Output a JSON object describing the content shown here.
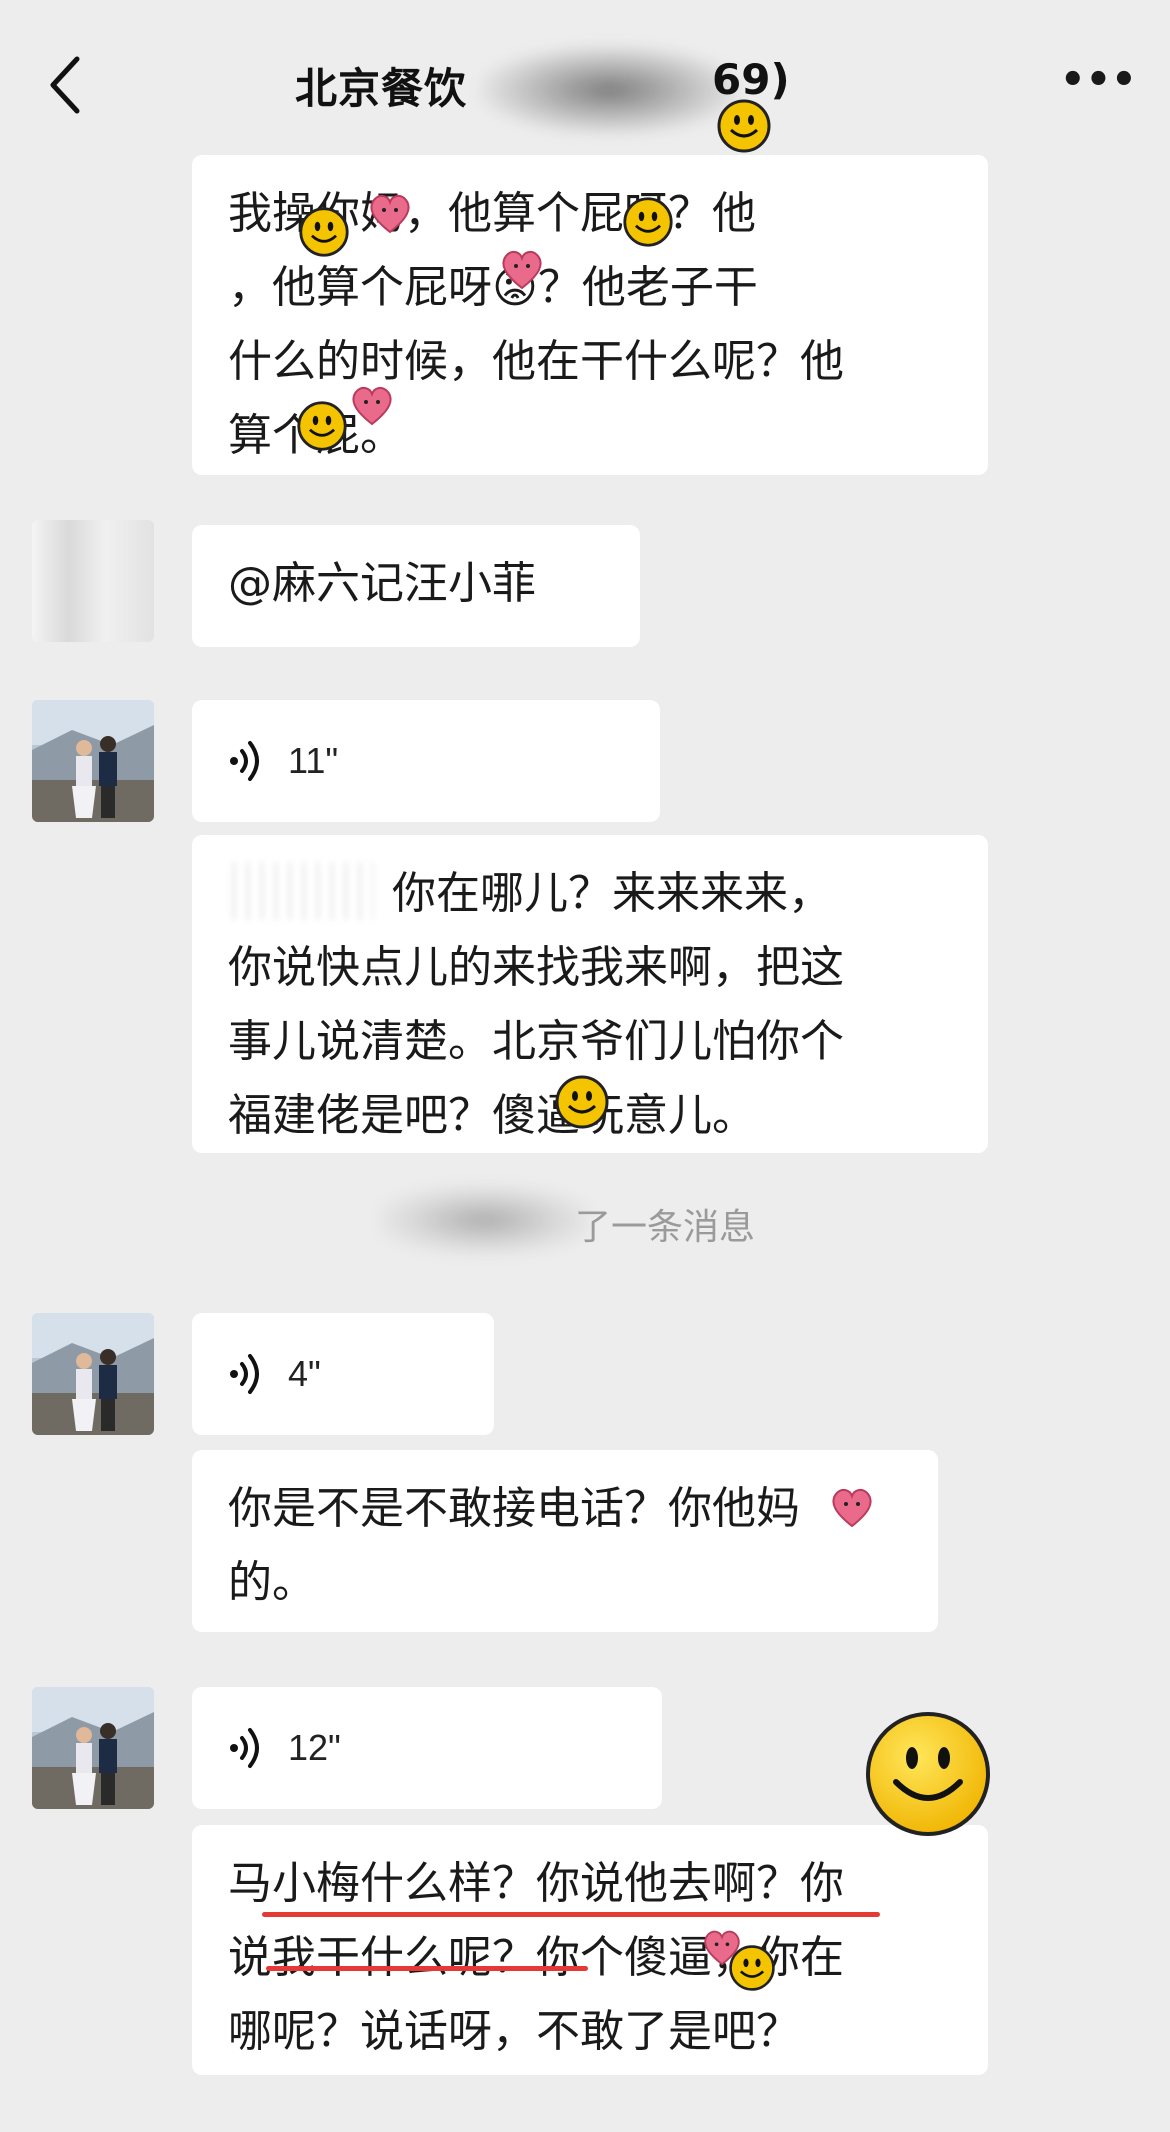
{
  "header": {
    "title": "北京餐饮",
    "title_tail": "69)",
    "back_icon": "chevron-left-icon",
    "more_icon": "more-icon",
    "more_label": "•••"
  },
  "messages": [
    {
      "kind": "text",
      "lines": [
        "我操你妈，他算个屁呀？他",
        "，他算个屁呀😡？他老子干",
        "什么的时候，他在干什么呢？他",
        "算个屁。"
      ]
    },
    {
      "kind": "text",
      "lines": [
        "@麻六记汪小菲"
      ]
    },
    {
      "kind": "voice",
      "duration": "11\""
    },
    {
      "kind": "text",
      "lines": [
        "，你在哪儿？来来来来，",
        "你说快点儿的来找我来啊，把这",
        "事儿说清楚。北京爷们儿怕你个",
        "福建佬是吧？傻逼玩意儿。"
      ]
    },
    {
      "kind": "voice",
      "duration": "4\""
    },
    {
      "kind": "text",
      "lines": [
        "你是不是不敢接电话？你他妈",
        "的。"
      ]
    },
    {
      "kind": "voice",
      "duration": "12\""
    },
    {
      "kind": "text",
      "lines": [
        "马小梅什么样？你说他去啊？你",
        "说我干什么呢？你个傻逼，你在",
        "哪呢？说话呀，不敢了是吧？"
      ]
    }
  ],
  "system_notice": "了一条消息",
  "colors": {
    "background": "#ededed",
    "bubble": "#ffffff",
    "underline": "#e53935",
    "smiley": "#f5c400",
    "heart": "#ea6a8c"
  }
}
